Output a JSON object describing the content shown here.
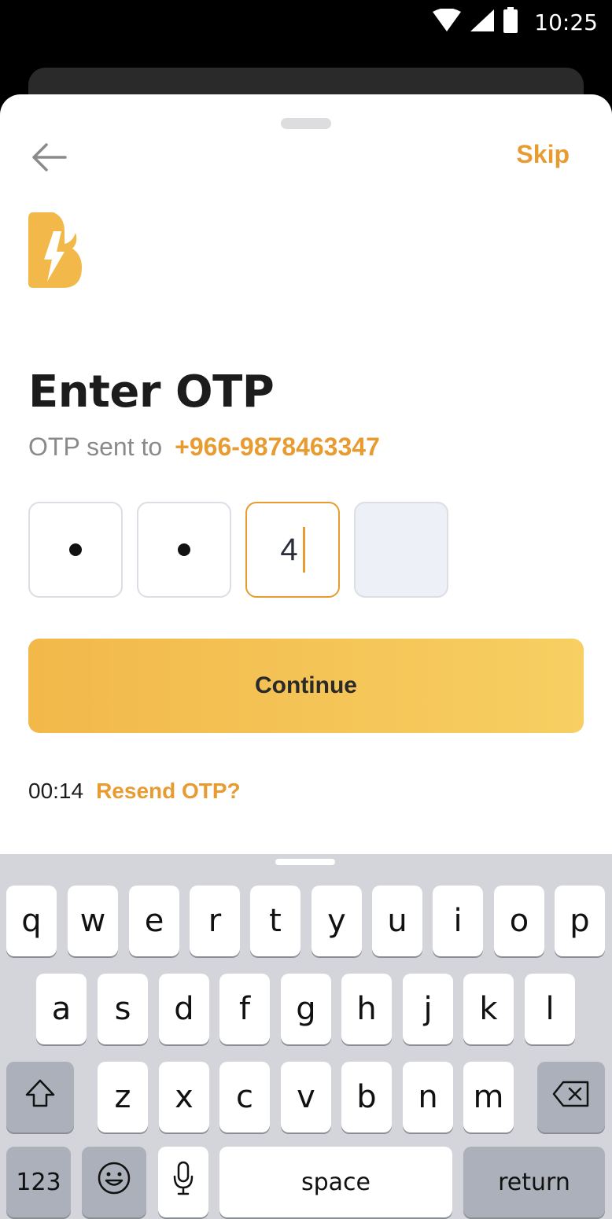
{
  "status": {
    "time": "10:25"
  },
  "header": {
    "skip_label": "Skip"
  },
  "main": {
    "title": "Enter OTP",
    "sent_label": "OTP sent to",
    "phone": "+966-9878463347",
    "otp": {
      "current_digit": "4"
    },
    "continue_label": "Continue",
    "timer": "00:14",
    "resend_label": "Resend OTP?"
  },
  "keyboard": {
    "row1": [
      "q",
      "w",
      "e",
      "r",
      "t",
      "y",
      "u",
      "i",
      "o",
      "p"
    ],
    "row2": [
      "a",
      "s",
      "d",
      "f",
      "g",
      "h",
      "j",
      "k",
      "l"
    ],
    "row3": [
      "z",
      "x",
      "c",
      "v",
      "b",
      "n",
      "m"
    ],
    "numbers_label": "123",
    "space_label": "space",
    "return_label": "return"
  },
  "colors": {
    "accent": "#e89b30",
    "button_start": "#f2b84a",
    "button_end": "#f7cf62"
  }
}
